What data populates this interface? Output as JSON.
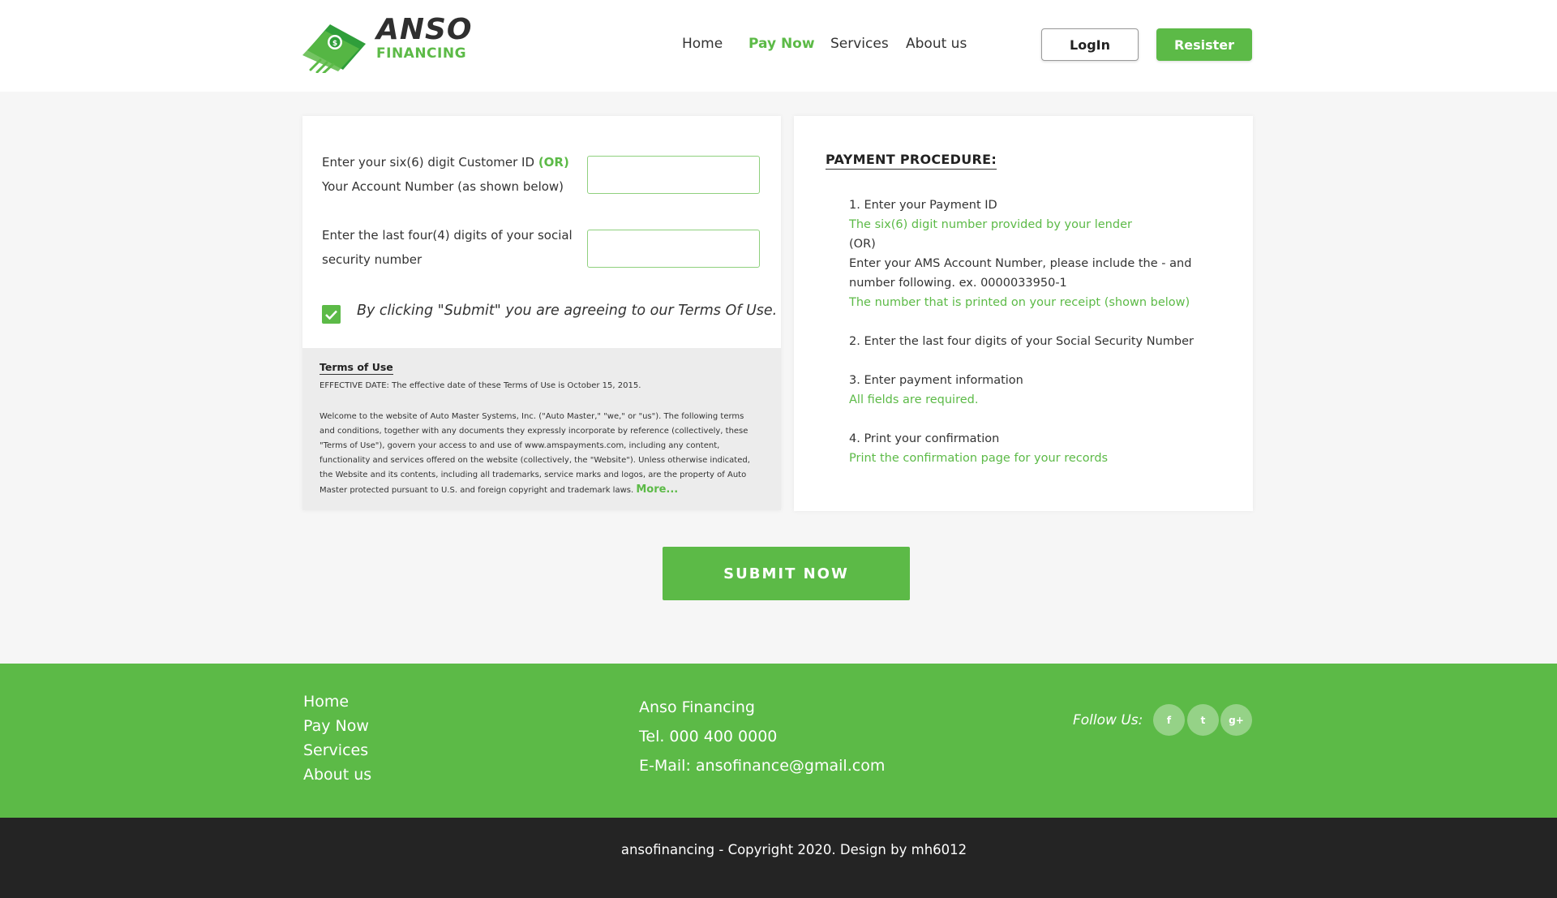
{
  "brand": {
    "name": "ANSO",
    "sub": "FINANCING"
  },
  "nav": [
    {
      "label": "Home",
      "active": false
    },
    {
      "label": "Pay Now",
      "active": true
    },
    {
      "label": "Services",
      "active": false
    },
    {
      "label": "About us",
      "active": false
    }
  ],
  "auth": {
    "login": "LogIn",
    "register": "Resister"
  },
  "form": {
    "customer_label_1": "Enter your six(6) digit Customer ID",
    "customer_or": "(OR)",
    "customer_label_2": "Your Account Number (as shown below)",
    "customer_value": "",
    "ssn_label": "Enter the last four(4) digits of your social security number",
    "ssn_value": "",
    "agree_text": "By clicking \"Submit\" you are agreeing to our Terms Of Use.",
    "agree_checked": true
  },
  "terms": {
    "title": "Terms of Use",
    "effective": "EFFECTIVE DATE: The effective date of these Terms of Use is October 15, 2015.",
    "body": "Welcome to the website of Auto Master Systems, Inc. (\"Auto Master,\" \"we,\" or \"us\"). The following terms and conditions, together with any documents they expressly incorporate by reference (collectively, these \"Terms of Use\"), govern your access to and use of www.amspayments.com, including any content, functionality and services offered on the website (collectively, the \"Website\"). Unless otherwise indicated, the Website and its contents, including all trademarks, service marks and logos, are the property of Auto Master protected pursuant to U.S. and foreign copyright and trademark laws.",
    "more": "More..."
  },
  "procedure": {
    "title": "PAYMENT PROCEDURE:",
    "s1": "1. Enter your Payment ID",
    "s1_g": "The six(6) digit number provided by your lender",
    "s1_or": "(OR)",
    "s1_b": "Enter your AMS Account Number, please include the - and number following. ex. 0000033950-1",
    "s1_g2": "The number that is printed on your receipt (shown below)",
    "s2": "2. Enter the last four digits of your Social Security Number",
    "s3": "3. Enter payment information",
    "s3_g": "All fields are required.",
    "s4": "4. Print your confirmation",
    "s4_g": "Print the confirmation page for your records"
  },
  "submit": "SUBMIT NOW",
  "footer": {
    "links": [
      "Home",
      "Pay Now",
      "Services",
      "About us"
    ],
    "company": "Anso Financing",
    "tel": "Tel. 000 400 0000",
    "email": "E-Mail: ansofinance@gmail.com",
    "follow": "Follow Us:",
    "social": [
      {
        "icon": "facebook-icon",
        "glyph": "f"
      },
      {
        "icon": "twitter-icon",
        "glyph": "t"
      },
      {
        "icon": "google-plus-icon",
        "glyph": "g+"
      }
    ],
    "copyright": "ansofinancing - Copyright 2020. Design by mh6012"
  },
  "colors": {
    "accent": "#5cba47",
    "dark": "#242424"
  }
}
